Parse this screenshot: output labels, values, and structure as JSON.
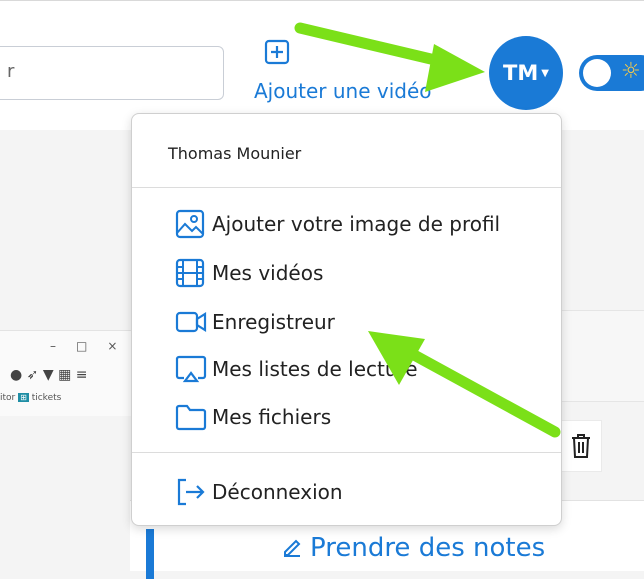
{
  "header": {
    "search_partial": "r",
    "add_video_label": "Ajouter une vidéo",
    "avatar_initials": "TM"
  },
  "user_menu": {
    "user_name": "Thomas Mounier",
    "items": [
      {
        "label": "Ajouter votre image de profil",
        "icon": "image-icon"
      },
      {
        "label": "Mes vidéos",
        "icon": "film-icon"
      },
      {
        "label": "Enregistreur",
        "icon": "video-camera-icon"
      },
      {
        "label": "Mes listes de lecture",
        "icon": "playlist-screen-icon"
      },
      {
        "label": "Mes fichiers",
        "icon": "folder-icon"
      }
    ],
    "logout_label": "Déconnexion"
  },
  "background": {
    "notes_button_label": "Prendre des notes",
    "screenshot_tab_text_1": "itor",
    "screenshot_tab_text_2": "tickets"
  },
  "colors": {
    "accent": "#1a7ad6",
    "annotation_arrow": "#7be018"
  }
}
